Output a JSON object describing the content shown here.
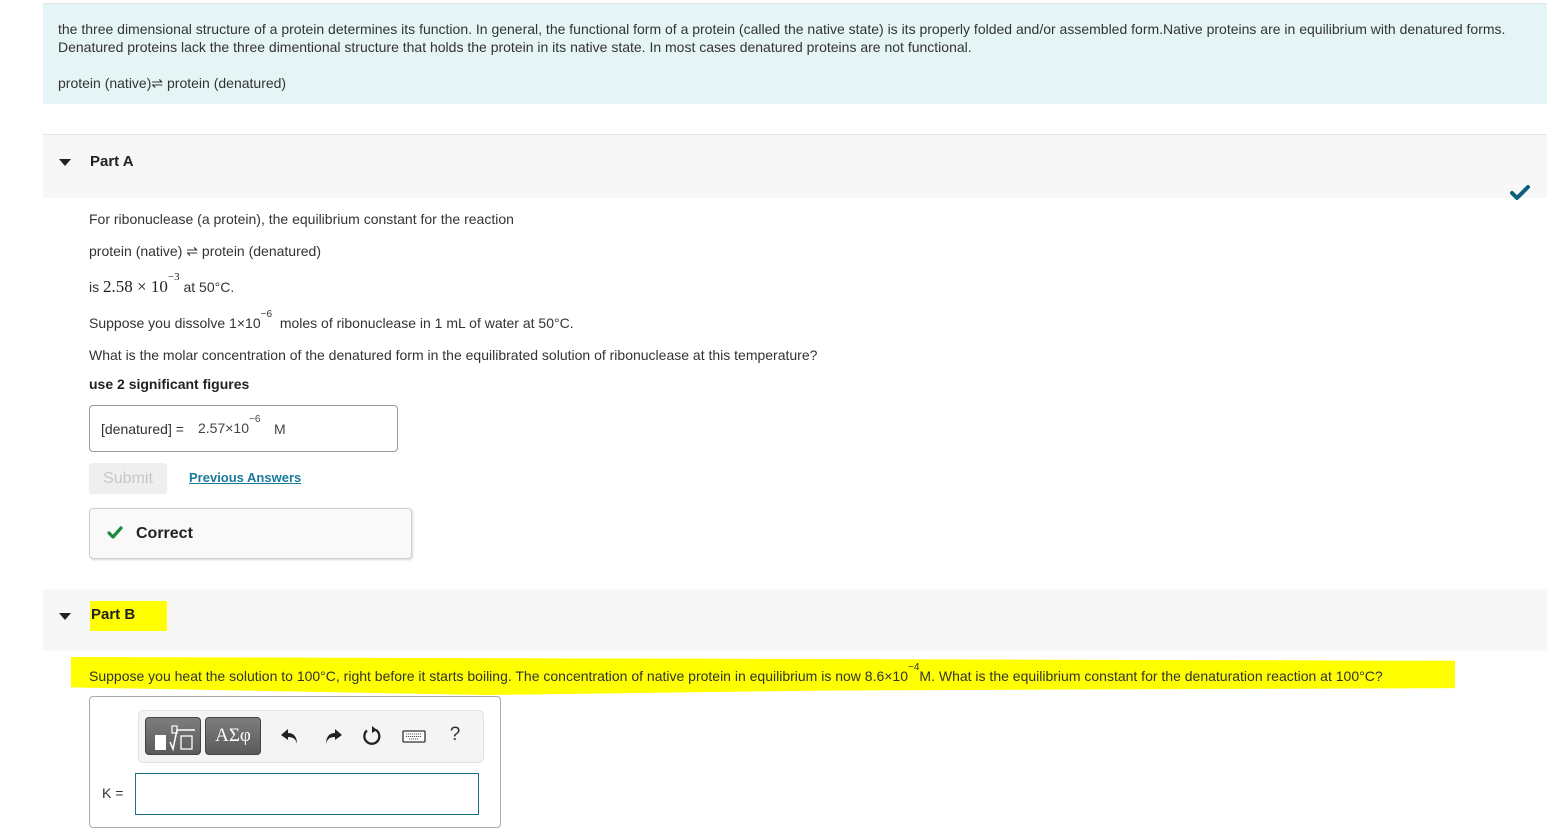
{
  "intro": {
    "paragraph": "the three dimensional structure of a protein determines its function. In general, the functional form of a protein (called the native state) is its properly folded and/or assembled form.Native proteins are in equilibrium with denatured forms. Denatured proteins lack the three dimentional structure that holds the protein in its native state. In most cases denatured proteins are not functional.",
    "equation_left": "protein (native)",
    "equation_arrow": "⇌",
    "equation_right": "protein (denatured)"
  },
  "partA": {
    "title": "Part A",
    "status": "completed",
    "line1": "For ribonuclease (a protein), the equilibrium constant for the reaction",
    "reaction_left": "protein (native)",
    "reaction_arrow": "⇌",
    "reaction_right": "protein (denatured)",
    "k_prefix": "is",
    "k_mantissa": "2.58 × 10",
    "k_exponent": "−3",
    "k_suffix": "at 50°C.",
    "dissolve_prefix": "Suppose you dissolve 1×10",
    "dissolve_exponent": "−6",
    "dissolve_suffix": "moles of ribonuclease in 1 mL of water at 50°C.",
    "question": "What is the molar concentration of the denatured form in the equilibrated solution of ribonuclease at this temperature?",
    "instruction": "use 2 significant figures",
    "answer_label": "[denatured] =",
    "answer_value_mantissa": "2.57×10",
    "answer_value_exponent": "−6",
    "answer_unit": "M",
    "submit_label": "Submit",
    "previous_answers_label": "Previous Answers",
    "feedback": "Correct"
  },
  "partB": {
    "title": "Part B",
    "question_part1": "Suppose you heat the solution to 100°C, right before it starts boiling. The concentration of native protein in equilibrium is now 8.6×10",
    "question_exponent": "−4",
    "question_part2": "M. What is the equilibrium constant for the denaturation reaction at 100°C?",
    "toolbar": {
      "templates_icon": "templates-root-icon",
      "greek_label": "ΑΣφ",
      "undo_icon": "undo-icon",
      "redo_icon": "redo-icon",
      "reset_icon": "reset-icon",
      "keyboard_icon": "keyboard-icon",
      "help_label": "?"
    },
    "input_label": "K =",
    "input_value": ""
  },
  "colors": {
    "intro_bg": "#e5f5f6",
    "header_bg": "#f7f7f7",
    "highlight": "#ffff00",
    "link": "#1a7a9c",
    "correct_green": "#1e8a3c",
    "done_check": "#0d5f7a"
  }
}
